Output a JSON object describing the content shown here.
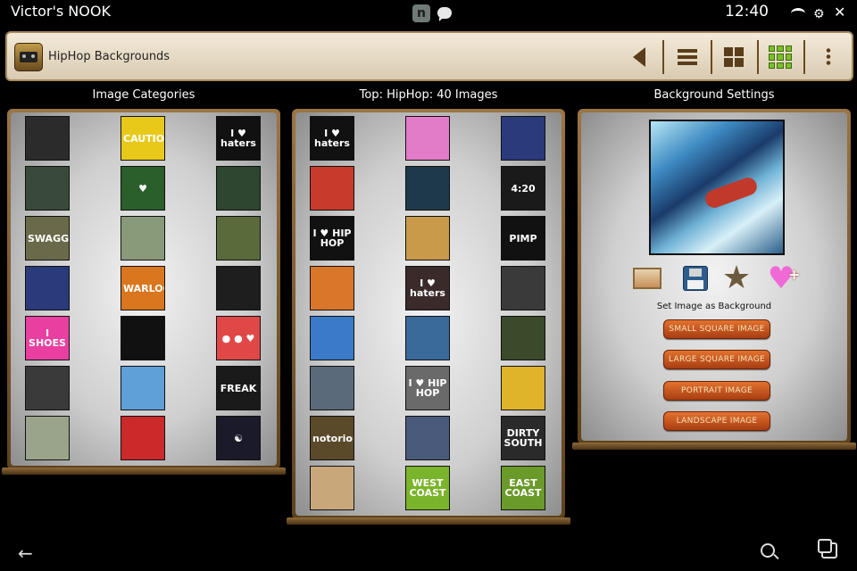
{
  "status": {
    "device_name": "Victor's NOOK",
    "time": "12:40"
  },
  "actionbar": {
    "title": "HipHop Backgrounds"
  },
  "columns": {
    "categories_title": "Image Categories",
    "images_title": "Top: HipHop: 40 Images",
    "settings_title": "Background Settings"
  },
  "categories": [
    {
      "text": "",
      "bg": "#2b2b2b"
    },
    {
      "text": "CAUTION",
      "bg": "#e8c91a"
    },
    {
      "text": "I ♥ haters",
      "bg": "#111111"
    },
    {
      "text": "",
      "bg": "#3a4a3a"
    },
    {
      "text": "♥",
      "bg": "#2a5e2a"
    },
    {
      "text": "",
      "bg": "#2e4530"
    },
    {
      "text": "SWAGGER",
      "bg": "#6a6a4a"
    },
    {
      "text": "",
      "bg": "#889a7a"
    },
    {
      "text": "",
      "bg": "#5a6a3a"
    },
    {
      "text": "",
      "bg": "#2a3a7a"
    },
    {
      "text": "WARLOCK",
      "bg": "#d9761e"
    },
    {
      "text": "",
      "bg": "#1e1e1e"
    },
    {
      "text": "I SHOES",
      "bg": "#e83fa0"
    },
    {
      "text": "",
      "bg": "#111111"
    },
    {
      "text": "● ● ♥",
      "bg": "#e04848"
    },
    {
      "text": "",
      "bg": "#3a3a3a"
    },
    {
      "text": "",
      "bg": "#5fa0d8"
    },
    {
      "text": "FREAK",
      "bg": "#1a1a1a"
    },
    {
      "text": "",
      "bg": "#9aa48a"
    },
    {
      "text": "",
      "bg": "#cc2a2a"
    },
    {
      "text": "☯",
      "bg": "#1a1a2a"
    }
  ],
  "images": [
    {
      "text": "I ♥ haters",
      "bg": "#111111"
    },
    {
      "text": "",
      "bg": "#e27bc8"
    },
    {
      "text": "",
      "bg": "#2a3a7a"
    },
    {
      "text": "",
      "bg": "#c83a2a"
    },
    {
      "text": "",
      "bg": "#1e3a4a"
    },
    {
      "text": "4:20",
      "bg": "#1a1a1a"
    },
    {
      "text": "I ♥ HIP HOP",
      "bg": "#111111"
    },
    {
      "text": "",
      "bg": "#c89a4a"
    },
    {
      "text": "PIMP",
      "bg": "#111111"
    },
    {
      "text": "",
      "bg": "#d9762a"
    },
    {
      "text": "I ♥ haters",
      "bg": "#3a2a2a"
    },
    {
      "text": "",
      "bg": "#3a3a3a"
    },
    {
      "text": "",
      "bg": "#3a7ac8"
    },
    {
      "text": "",
      "bg": "#3a6a9a"
    },
    {
      "text": "",
      "bg": "#3a4a2a"
    },
    {
      "text": "",
      "bg": "#5a6a7a"
    },
    {
      "text": "I ♥ HIP HOP",
      "bg": "#6a6a6a"
    },
    {
      "text": "",
      "bg": "#e0b42a"
    },
    {
      "text": "notorious",
      "bg": "#5a4a2a"
    },
    {
      "text": "",
      "bg": "#4a5a7a"
    },
    {
      "text": "DIRTY SOUTH",
      "bg": "#2a2a2a"
    },
    {
      "text": "",
      "bg": "#c8a87a"
    },
    {
      "text": "WEST COAST",
      "bg": "#7ab42a"
    },
    {
      "text": "EAST COAST",
      "bg": "#6a9a2a"
    }
  ],
  "settings": {
    "set_label": "Set Image as Background",
    "buttons": [
      "SMALL SQUARE IMAGE",
      "LARGE SQUARE IMAGE",
      "PORTRAIT IMAGE",
      "LANDSCAPE IMAGE"
    ]
  }
}
